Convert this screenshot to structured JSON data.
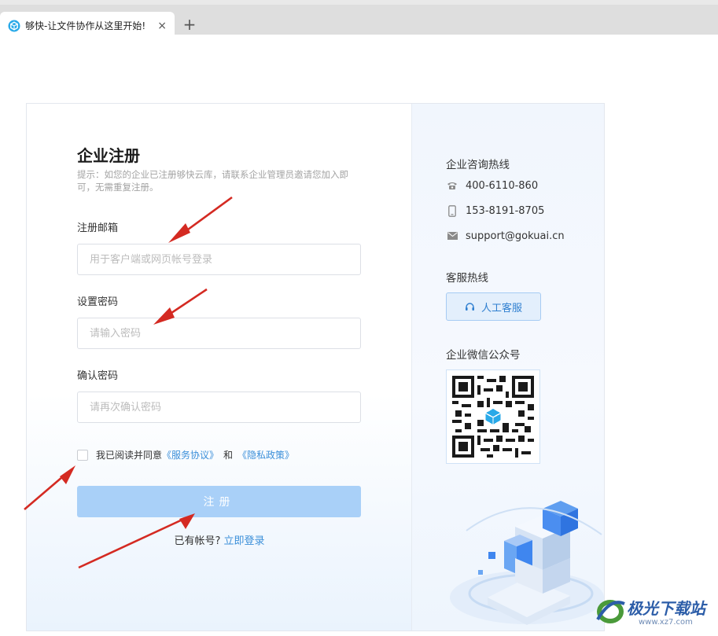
{
  "browser": {
    "tab_title": "够快-让文件协作从这里开始!",
    "tab_close": "×",
    "new_tab": "+"
  },
  "form": {
    "title": "企业注册",
    "tip": "提示：如您的企业已注册够快云库，请联系企业管理员邀请您加入即可，无需重复注册。",
    "email_label": "注册邮箱",
    "email_placeholder": "用于客户端或网页帐号登录",
    "password_label": "设置密码",
    "password_placeholder": "请输入密码",
    "confirm_label": "确认密码",
    "confirm_placeholder": "请再次确认密码",
    "agree_text": "我已阅读并同意",
    "terms_link": "《服务协议》",
    "and_text": "和",
    "privacy_link": "《隐私政策》",
    "submit_label": "注册",
    "have_account": "已有帐号?",
    "login_link": "立即登录"
  },
  "contact": {
    "hotline_title": "企业咨询热线",
    "phone": "400-6110-860",
    "mobile": "153-8191-8705",
    "email": "support@gokuai.cn",
    "service_title": "客服热线",
    "service_button": "人工客服",
    "wechat_title": "企业微信公众号"
  },
  "watermark": {
    "text": "极光下载站",
    "url": "www.xz7.com"
  },
  "colors": {
    "accent": "#3b8fd9",
    "submit_bg": "#a9d0f8",
    "arrow": "#d42a22"
  }
}
